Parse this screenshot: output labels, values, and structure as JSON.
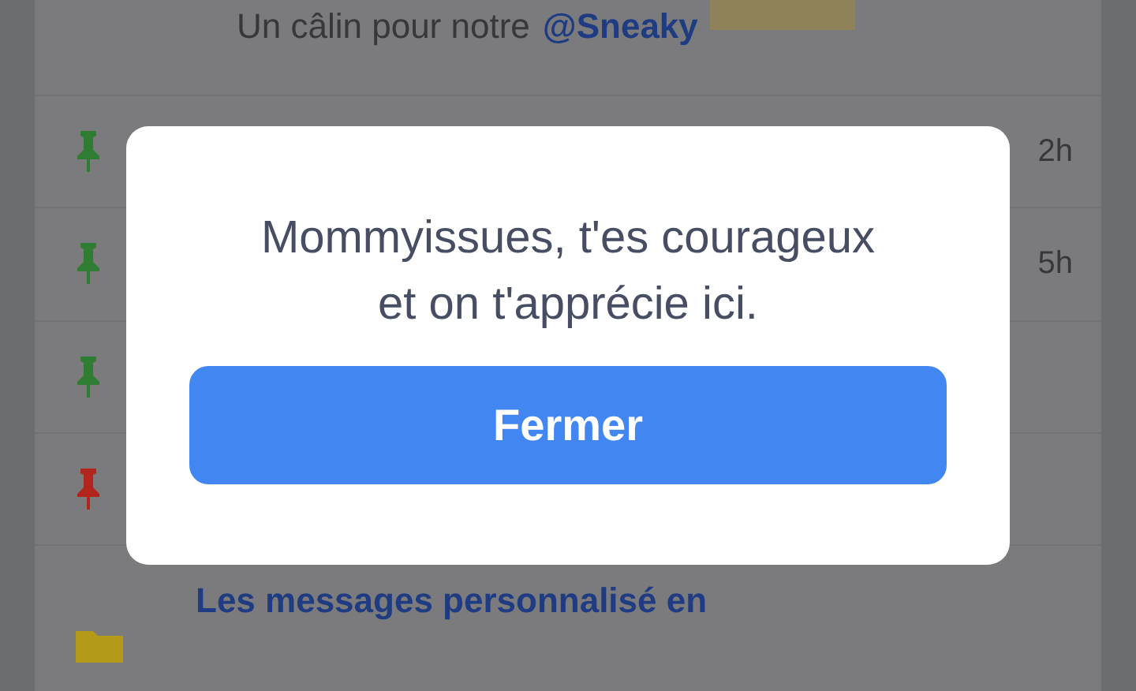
{
  "feed": {
    "intro": {
      "text": "Un câlin pour notre",
      "mention": "@Sneaky"
    },
    "rows": [
      {
        "kind": "pin",
        "color": "#2e7d32",
        "time": "2h"
      },
      {
        "kind": "pin",
        "color": "#2e7d32",
        "time": "5h"
      },
      {
        "kind": "pin",
        "color": "#2e7d32"
      },
      {
        "kind": "pin",
        "color": "#b3261e"
      },
      {
        "kind": "folder",
        "color": "#b59a1a",
        "title": "Les messages personnalisé en"
      }
    ]
  },
  "dialog": {
    "message": "Mommyissues, t'es courageux et on t'apprécie ici.",
    "button": "Fermer"
  }
}
